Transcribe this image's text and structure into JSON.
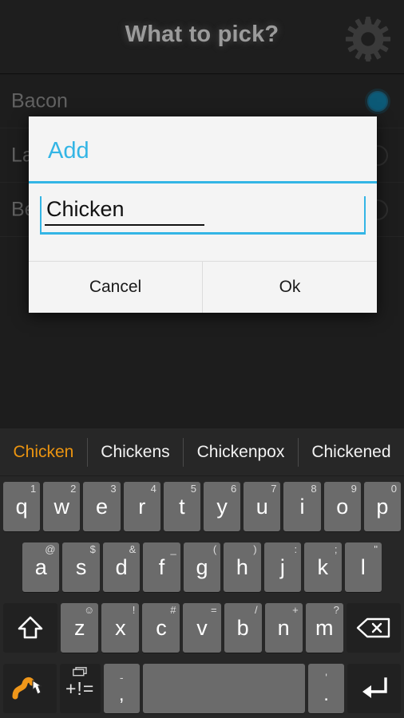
{
  "header": {
    "title": "What to pick?",
    "gear_icon": "gear-icon"
  },
  "background_list": {
    "items": [
      {
        "label": "Bacon",
        "selected": true
      },
      {
        "label": "Lamb",
        "selected": false
      },
      {
        "label": "Beef",
        "selected": false
      }
    ]
  },
  "dialog": {
    "title": "Add",
    "input": {
      "value": "Chicken",
      "placeholder": ""
    },
    "cancel_label": "Cancel",
    "ok_label": "Ok",
    "accent_color": "#33b5e5"
  },
  "keyboard": {
    "suggestions": [
      {
        "text": "Chicken",
        "active": true
      },
      {
        "text": "Chickens",
        "active": false
      },
      {
        "text": "Chickenpox",
        "active": false
      },
      {
        "text": "Chickened",
        "active": false
      }
    ],
    "suggestion_active_color": "#eb9410",
    "row1": [
      {
        "key": "q",
        "alt": "1"
      },
      {
        "key": "w",
        "alt": "2"
      },
      {
        "key": "e",
        "alt": "3"
      },
      {
        "key": "r",
        "alt": "4"
      },
      {
        "key": "t",
        "alt": "5"
      },
      {
        "key": "y",
        "alt": "6"
      },
      {
        "key": "u",
        "alt": "7"
      },
      {
        "key": "i",
        "alt": "8"
      },
      {
        "key": "o",
        "alt": "9"
      },
      {
        "key": "p",
        "alt": "0"
      }
    ],
    "row2": [
      {
        "key": "a",
        "alt": "@"
      },
      {
        "key": "s",
        "alt": "$"
      },
      {
        "key": "d",
        "alt": "&"
      },
      {
        "key": "f",
        "alt": "_"
      },
      {
        "key": "g",
        "alt": "("
      },
      {
        "key": "h",
        "alt": ")"
      },
      {
        "key": "j",
        "alt": ":"
      },
      {
        "key": "k",
        "alt": ";"
      },
      {
        "key": "l",
        "alt": "\""
      }
    ],
    "row3": {
      "shift_icon": "shift-icon",
      "letters": [
        {
          "key": "z",
          "alt": "☺"
        },
        {
          "key": "x",
          "alt": "!"
        },
        {
          "key": "c",
          "alt": "#"
        },
        {
          "key": "v",
          "alt": "="
        },
        {
          "key": "b",
          "alt": "/"
        },
        {
          "key": "n",
          "alt": "+"
        },
        {
          "key": "m",
          "alt": "?"
        }
      ],
      "backspace_icon": "backspace-icon"
    },
    "row4": {
      "gesture_icon": "swipe-gesture-icon",
      "symbols_label": "+!=",
      "symbols_alt_icon": "window-icon",
      "comma_top": "-",
      "comma_bottom": ",",
      "space_label": "",
      "period_top": "'",
      "period_bottom": ".",
      "enter_icon": "enter-icon"
    }
  }
}
